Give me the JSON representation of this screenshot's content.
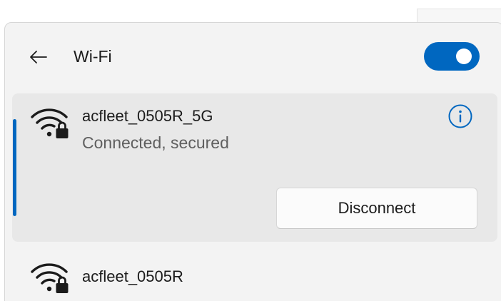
{
  "header": {
    "back_icon": "back-arrow-icon",
    "title": "Wi-Fi",
    "toggle_on": true,
    "accent_color": "#0067c0"
  },
  "networks": [
    {
      "name": "acfleet_0505R_5G",
      "status": "Connected, secured",
      "icon": "wifi-secured-icon",
      "connected": true,
      "info_icon": "info-icon",
      "action_label": "Disconnect"
    },
    {
      "name": "acfleet_0505R",
      "icon": "wifi-secured-icon",
      "connected": false
    }
  ]
}
